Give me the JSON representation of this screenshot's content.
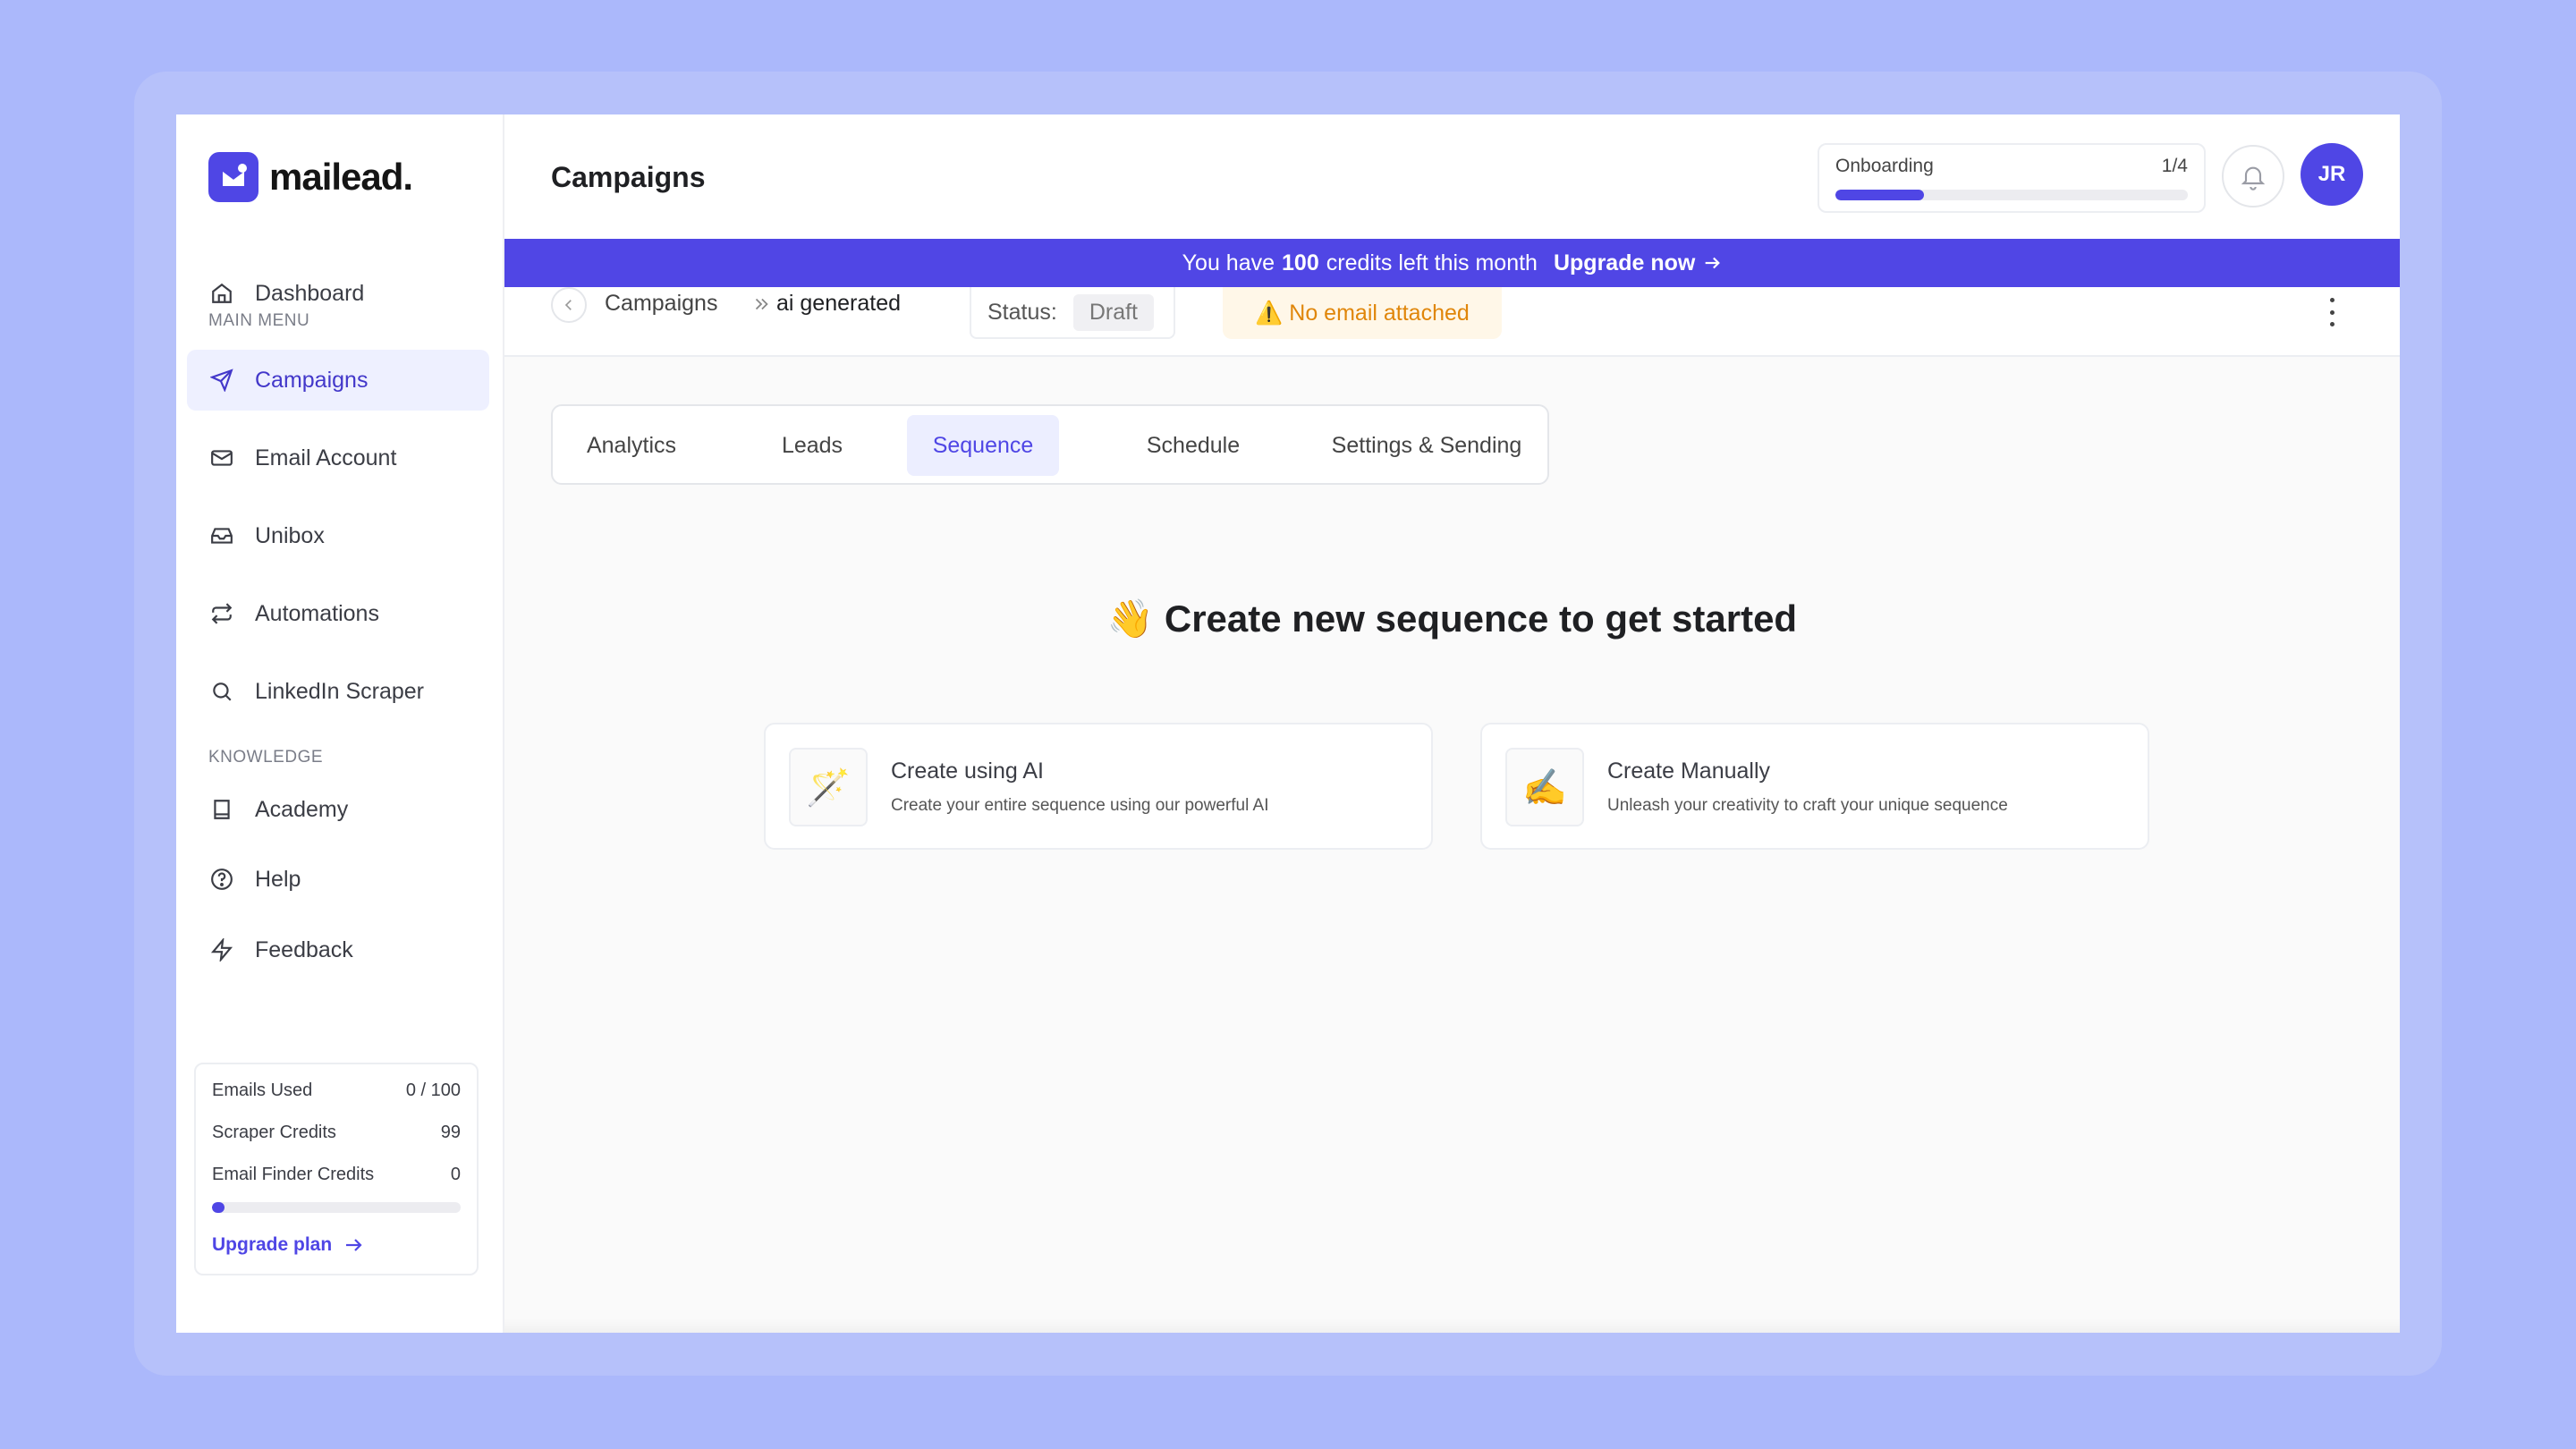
{
  "brand": {
    "name": "mailead.",
    "color": "#4f46e5"
  },
  "sidebar": {
    "dashboard": "Dashboard",
    "main_menu_label": "MAIN MENU",
    "main_items": [
      {
        "label": "Campaigns",
        "icon": "send-icon",
        "active": true
      },
      {
        "label": "Email Account",
        "icon": "mail-icon"
      },
      {
        "label": "Unibox",
        "icon": "inbox-icon"
      },
      {
        "label": "Automations",
        "icon": "repeat-icon"
      },
      {
        "label": "LinkedIn Scraper",
        "icon": "search-icon"
      }
    ],
    "knowledge_label": "KNOWLEDGE",
    "knowledge_items": [
      {
        "label": "Academy",
        "icon": "book-icon"
      },
      {
        "label": "Help",
        "icon": "help-circle-icon"
      },
      {
        "label": "Feedback",
        "icon": "zap-icon"
      }
    ],
    "credits": {
      "emails_used_label": "Emails Used",
      "emails_used_value": "0 / 100",
      "scraper_label": "Scraper Credits",
      "scraper_value": "99",
      "finder_label": "Email Finder Credits",
      "finder_value": "0",
      "usage_fraction": 0.05,
      "upgrade_label": "Upgrade plan"
    }
  },
  "header": {
    "title": "Campaigns",
    "onboarding": {
      "label": "Onboarding",
      "progress_text": "1/4",
      "progress_fraction": 0.25
    },
    "avatar_initials": "JR"
  },
  "banner": {
    "prefix": "You have",
    "credits": "100",
    "suffix": "credits left this month",
    "cta": "Upgrade now"
  },
  "subbar": {
    "crumb_root": "Campaigns",
    "crumb_current": "ai generated",
    "status_label": "Status:",
    "status_value": "Draft",
    "warning": "⚠️ No email attached"
  },
  "tabs": [
    "Analytics",
    "Leads",
    "Sequence",
    "Schedule",
    "Settings & Sending"
  ],
  "active_tab": "Sequence",
  "content": {
    "headline": "👋 Create new sequence to get started",
    "cards": [
      {
        "icon": "🪄",
        "title": "Create using AI",
        "desc": "Create your entire sequence using our powerful AI"
      },
      {
        "icon": "✍️",
        "title": "Create Manually",
        "desc": "Unleash your creativity to craft your unique sequence"
      }
    ]
  }
}
